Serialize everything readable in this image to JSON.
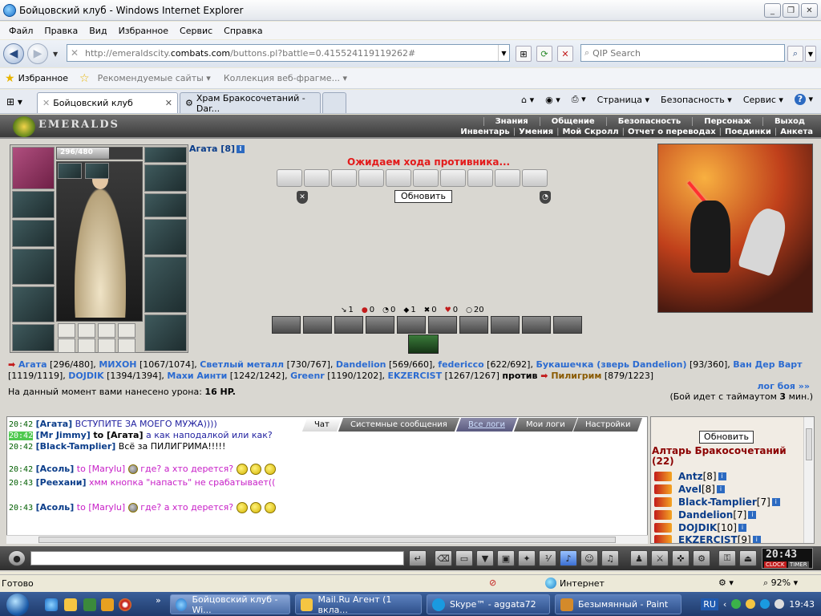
{
  "window": {
    "title": "Бойцовский клуб - Windows Internet Explorer",
    "minimize": "_",
    "maximize": "❐",
    "close": "✕"
  },
  "menu": [
    "Файл",
    "Правка",
    "Вид",
    "Избранное",
    "Сервис",
    "Справка"
  ],
  "address": {
    "prefix": "http://emeraldscity.",
    "domain": "combats.com",
    "suffix": "/buttons.pl?battle=0.415524119119262#"
  },
  "search": {
    "placeholder": "QIP Search"
  },
  "favorites": {
    "label": "Избранное",
    "recommended": "Рекомендуемые сайты",
    "gallery": "Коллекция веб-фрагме..."
  },
  "tabs": [
    {
      "label": "Бойцовский клуб",
      "close": "✕"
    },
    {
      "label": "Храм Бракосочетаний - Dar..."
    }
  ],
  "commandbar": {
    "page": "Страница",
    "safety": "Безопасность",
    "tools": "Сервис",
    "help": "?"
  },
  "game": {
    "logo": "EMERALDS",
    "topnav": [
      "Знания",
      "Общение",
      "Безопасность",
      "Персонаж",
      "Выход"
    ],
    "subnav": [
      "Инвентарь",
      "Умения",
      "Мой Скролл",
      "Отчет о переводах",
      "Поединки",
      "Анкета"
    ],
    "hp_text": "296/480",
    "hp_fraction": 0.617,
    "char_name": "Агата [8]",
    "info_icon": "i",
    "waiting": "Ожидаем хода противника...",
    "update_button": "Обновить",
    "stats": [
      {
        "icon": "↘",
        "value": "1"
      },
      {
        "icon": "●",
        "value": "0"
      },
      {
        "icon": "◔",
        "value": "0"
      },
      {
        "icon": "◆",
        "value": "1"
      },
      {
        "icon": "✖",
        "value": "0"
      },
      {
        "icon": "♥",
        "value": "0"
      },
      {
        "icon": "○",
        "value": "20"
      }
    ],
    "team_text": "Агата",
    "team": [
      {
        "name": "Агата",
        "hp": "[296/480]"
      },
      {
        "name": "МИХОН",
        "hp": "[1067/1074]"
      },
      {
        "name": "Светлый металл",
        "hp": "[730/767]"
      },
      {
        "name": "Dandelion",
        "hp": "[569/660]"
      },
      {
        "name": "federicco",
        "hp": "[622/692]"
      },
      {
        "name": "Букашечка (зверь Dandelion)",
        "hp": "[93/360]"
      },
      {
        "name": "Ван Дер Варт",
        "hp": "[1119/1119]"
      },
      {
        "name": "DOJDIK",
        "hp": "[1394/1394]"
      },
      {
        "name": "Махи Аинти",
        "hp": "[1242/1242]"
      },
      {
        "name": "Greenr",
        "hp": "[1190/1202]"
      },
      {
        "name": "EKZERCIST",
        "hp": "[1267/1267]"
      }
    ],
    "versus": "против",
    "enemy": {
      "name": "Пилигрим",
      "hp": "[879/1223]"
    },
    "damage_prefix": "На данный момент вами нанесено урона:",
    "damage_value": "16 HP.",
    "battle_log": "лог боя »»",
    "timeout_prefix": "(Бой идет с таймаутом",
    "timeout_value": "3",
    "timeout_suffix": "мин.)"
  },
  "chat": {
    "tabs": [
      "Чат",
      "Системные сообщения",
      "Все логи",
      "Мои логи",
      "Настройки"
    ],
    "lines": [
      {
        "time": "20:42",
        "nick": "[Агата]",
        "text": "ВСТУПИТЕ ЗА МОЕГО МУЖА))))"
      },
      {
        "time": "20:42",
        "nick": "[Mr Jimmy]",
        "to": "to [Агата]",
        "text": "а как наподалкой или как?"
      },
      {
        "time": "20:42",
        "nick": "[Black-Tamplier]",
        "text": "Всё за ПИЛИГРИМА!!!!!"
      },
      {
        "time": "20:42",
        "nick": "[Асоль]",
        "to": "to [Marylu]",
        "text": "где? а хто дерется?"
      },
      {
        "time": "20:43",
        "nick": "[Реехани]",
        "text": "хмм кнопка \"напасть\" не срабатывает(("
      },
      {
        "time": "20:43",
        "nick": "[Асоль]",
        "to": "to [Marylu]",
        "text": "где? а хто дерется?"
      }
    ]
  },
  "altar": {
    "update_button": "Обновить",
    "room_title": "Алтарь Бракосочетаний (22)",
    "users": [
      {
        "name": "Antz",
        "level": "[8]"
      },
      {
        "name": "Avel",
        "level": "[8]"
      },
      {
        "name": "Black-Tamplier",
        "level": "[7]"
      },
      {
        "name": "Dandelion",
        "level": "[7]"
      },
      {
        "name": "DOJDIK",
        "level": "[10]"
      },
      {
        "name": "EKZERCIST",
        "level": "[9]"
      }
    ]
  },
  "clock": {
    "time": "20:43",
    "label1": "CLOCK",
    "label2": "TIMER"
  },
  "status": {
    "ready": "Готово",
    "zone": "Интернет",
    "zoom": "92%"
  },
  "taskbar": {
    "tasks": [
      "Бойцовский клуб - Wi...",
      "Mail.Ru Агент (1 вкла...",
      "Skype™ - aggata72",
      "Безымянный - Paint"
    ],
    "lang": "RU",
    "time": "19:43"
  }
}
